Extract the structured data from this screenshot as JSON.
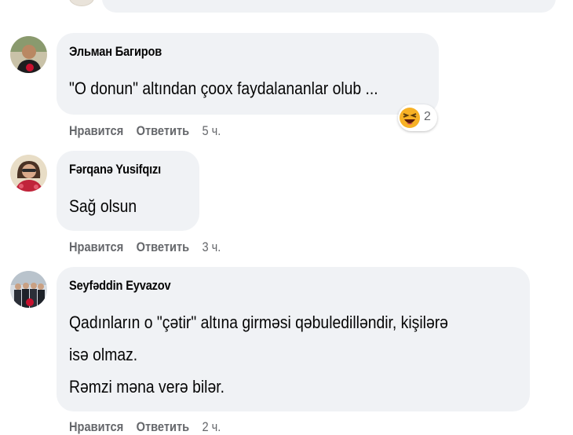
{
  "comments": [
    {
      "author": "Эльман Багиров",
      "lines": [
        "\"O donun\" altından çoox faydalananlar olub ..."
      ],
      "like_label": "Нравится",
      "reply_label": "Ответить",
      "time": "5 ч.",
      "reaction": {
        "icon": "laughing-emoji-icon",
        "count": "2"
      }
    },
    {
      "author": "Fərqanə Yusifqızı",
      "lines": [
        "Sağ olsun"
      ],
      "like_label": "Нравится",
      "reply_label": "Ответить",
      "time": "3 ч."
    },
    {
      "author": "Seyfəddin Eyvazov",
      "lines": [
        "Qadınların o \"çətir\" altına girməsi qəbuledilləndir, kişilərə",
        "isə olmaz.",
        "Rəmzi məna verə bilər."
      ],
      "like_label": "Нравится",
      "reply_label": "Ответить",
      "time": "2 ч."
    }
  ],
  "colors": {
    "bubble": "#f0f2f5",
    "meta": "#65676b",
    "text": "#050505",
    "emoji": "#f7b125"
  }
}
